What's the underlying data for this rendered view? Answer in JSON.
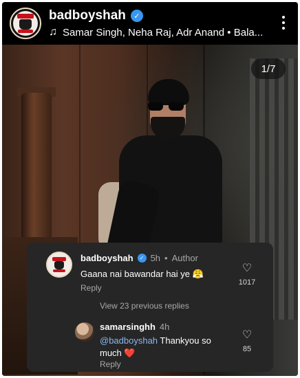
{
  "header": {
    "username": "badboyshah",
    "verified_mark": "✓",
    "music_icon": "♫",
    "music_text": "Samar Singh, Neha Raj, Adr Anand • Bala..."
  },
  "post": {
    "counter": "1/7"
  },
  "comments": [
    {
      "username": "badboyshah",
      "verified_mark": "✓",
      "time": "5h",
      "separator": "•",
      "role": "Author",
      "text": "Gaana nai bawandar hai ye",
      "emoji": "😤",
      "reply_label": "Reply",
      "likes": "1017",
      "heart": "♡"
    },
    {
      "username": "samarsinghh",
      "time": "4h",
      "mention": "@badboyshah",
      "text": " Thankyou so much",
      "emoji": "❤️",
      "reply_label": "Reply",
      "likes": "85",
      "heart": "♡"
    }
  ],
  "view_replies": "View 23 previous replies",
  "colors": {
    "verified_blue": "#3897f0",
    "card_bg": "#262626",
    "mention_blue": "#8ab8f0",
    "logo_red": "#c5121b"
  },
  "icons": [
    "music-note-icon",
    "verified-icon",
    "more-options-icon",
    "heart-icon"
  ]
}
